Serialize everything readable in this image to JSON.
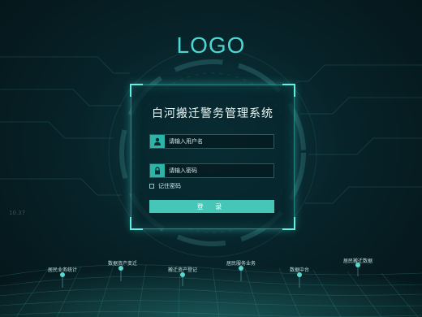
{
  "logo": "LOGO",
  "login": {
    "title": "白河搬迁警务管理系统",
    "username_placeholder": "请输入用户名",
    "password_placeholder": "请输入密码",
    "remember_label": "记住密码",
    "login_button": "登 录"
  },
  "bottom_nav": [
    {
      "label": "居民业务统计"
    },
    {
      "label": "数据资产变迁"
    },
    {
      "label": "搬迁资产登记"
    },
    {
      "label": "居民服务业务"
    },
    {
      "label": "数据中台"
    },
    {
      "label": "居民搬迁数据"
    }
  ],
  "decor": {
    "side_number": "10.37"
  },
  "colors": {
    "accent": "#46c6b7",
    "logo": "#4fd6d0",
    "background": "#072329"
  }
}
